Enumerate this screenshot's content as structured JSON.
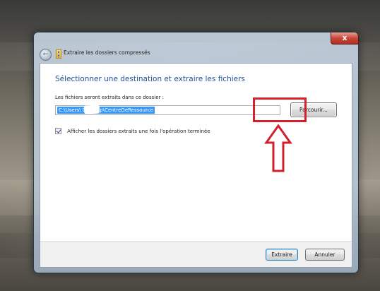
{
  "window": {
    "title": "Extraire les dossiers compressés",
    "close_label": "x"
  },
  "content": {
    "heading": "Sélectionner une destination et extraire les fichiers",
    "path_label": "Les fichiers seront extraits dans ce dossier :",
    "path_value": "C:\\Users\\        Desktop\\CentreDeRessource",
    "browse_label": "Parcourir...",
    "checkbox_label": "Afficher les dossiers extraits une fois l'opération terminée",
    "checkbox_checked": true
  },
  "footer": {
    "extract_label": "Extraire",
    "cancel_label": "Annuler"
  },
  "annotation": {
    "color": "#d0212c"
  }
}
